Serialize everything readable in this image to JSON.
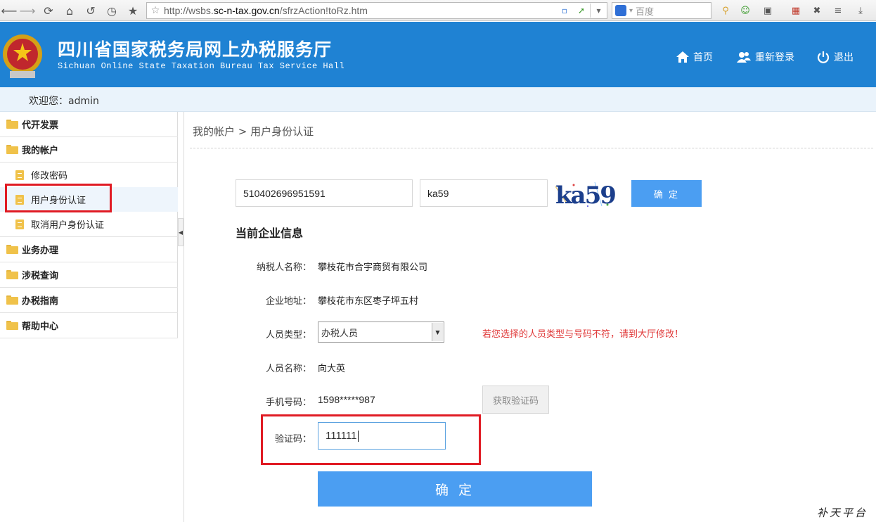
{
  "browser": {
    "url_prefix": "http://wsbs.",
    "url_domain": "sc-n-tax.gov.cn",
    "url_suffix": "/sfrzAction!toRz.htm",
    "search_placeholder": "百度"
  },
  "header": {
    "title": "四川省国家税务局网上办税服务厅",
    "subtitle": "Sichuan Online State Taxation Bureau Tax Service Hall",
    "nav": [
      {
        "label": "首页",
        "icon": "home-icon"
      },
      {
        "label": "重新登录",
        "icon": "users-icon"
      },
      {
        "label": "退出",
        "icon": "power-icon"
      }
    ]
  },
  "welcome_text": "欢迎您：admin",
  "sidebar": {
    "items": [
      {
        "label": "代开发票"
      },
      {
        "label": "我的帐户"
      },
      {
        "label": "修改密码"
      },
      {
        "label": "用户身份认证"
      },
      {
        "label": "取消用户身份认证"
      },
      {
        "label": "业务办理"
      },
      {
        "label": "涉税查询"
      },
      {
        "label": "办税指南"
      },
      {
        "label": "帮助中心"
      }
    ]
  },
  "breadcrumb": "我的帐户 > 用户身份认证",
  "verify": {
    "id_value": "510402696951591",
    "captcha_value": "ka59",
    "captcha_text": "ka59",
    "confirm_label": "确 定"
  },
  "company": {
    "section_title": "当前企业信息",
    "taxpayer_label": "纳税人名称：",
    "taxpayer_value": "攀枝花市合宇商贸有限公司",
    "address_label": "企业地址：",
    "address_value": "攀枝花市东区枣子坪五村",
    "type_label": "人员类型：",
    "type_value": "办税人员",
    "type_warning": "若您选择的人员类型与号码不符，请到大厅修改！",
    "name_label": "人员名称：",
    "name_value": "向大英",
    "phone_label": "手机号码：",
    "phone_value": "1598*****987",
    "get_code_label": "获取验证码",
    "code_label": "验证码：",
    "code_value": "111111",
    "submit_label": "确 定"
  },
  "watermark": "补天平台",
  "colors": {
    "header_bg": "#1f82d3",
    "button_blue": "#4b9ef2",
    "warning_red": "#e03b3b",
    "highlight_red": "#e01b24"
  }
}
